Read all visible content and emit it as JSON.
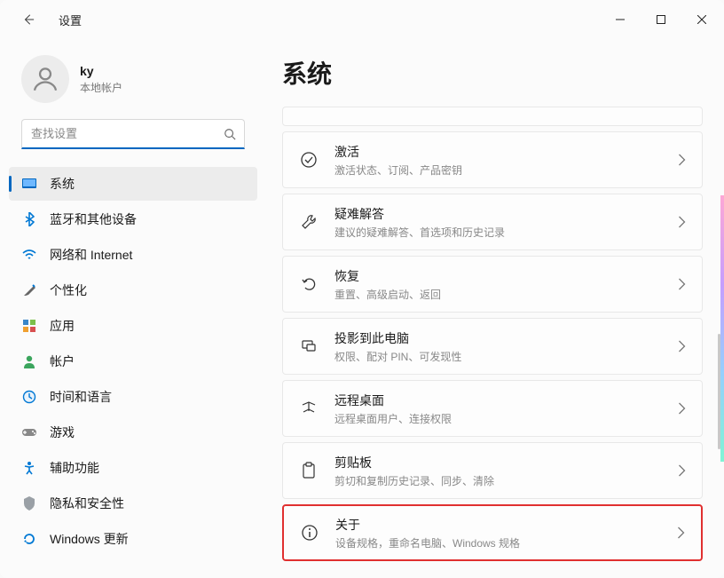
{
  "window": {
    "title": "设置"
  },
  "profile": {
    "name": "ky",
    "subtitle": "本地帐户"
  },
  "search": {
    "placeholder": "查找设置"
  },
  "nav": {
    "system": "系统",
    "bluetooth": "蓝牙和其他设备",
    "network": "网络和 Internet",
    "personalize": "个性化",
    "apps": "应用",
    "accounts": "帐户",
    "time": "时间和语言",
    "gaming": "游戏",
    "accessibility": "辅助功能",
    "privacy": "隐私和安全性",
    "update": "Windows 更新"
  },
  "page": {
    "title": "系统"
  },
  "cards": {
    "activation": {
      "title": "激活",
      "sub": "激活状态、订阅、产品密钥"
    },
    "troubleshoot": {
      "title": "疑难解答",
      "sub": "建议的疑难解答、首选项和历史记录"
    },
    "recovery": {
      "title": "恢复",
      "sub": "重置、高级启动、返回"
    },
    "project": {
      "title": "投影到此电脑",
      "sub": "权限、配对 PIN、可发现性"
    },
    "remote": {
      "title": "远程桌面",
      "sub": "远程桌面用户、连接权限"
    },
    "clipboard": {
      "title": "剪贴板",
      "sub": "剪切和复制历史记录、同步、清除"
    },
    "about": {
      "title": "关于",
      "sub": "设备规格，重命名电脑、Windows 规格"
    }
  }
}
